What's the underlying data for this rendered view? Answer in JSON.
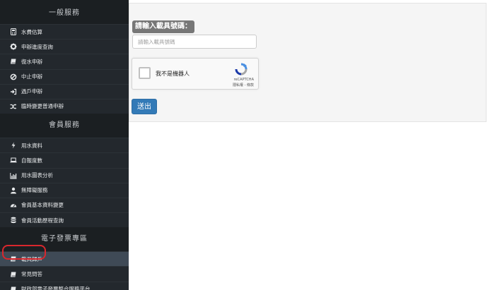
{
  "sidebar": {
    "sections": [
      {
        "title": "一般服務",
        "items": [
          {
            "label": "水費估算",
            "icon": "calculator-icon"
          },
          {
            "label": "申辦進度查詢",
            "icon": "gear-icon"
          },
          {
            "label": "復水申辦",
            "icon": "book-icon"
          },
          {
            "label": "中止申辦",
            "icon": "ban-icon"
          },
          {
            "label": "過戶申辦",
            "icon": "sign-in-icon"
          },
          {
            "label": "臨時變更普通申辦",
            "icon": "shuffle-icon"
          }
        ]
      },
      {
        "title": "會員服務",
        "items": [
          {
            "label": "用水資料",
            "icon": "bolt-icon"
          },
          {
            "label": "自報度數",
            "icon": "laptop-icon"
          },
          {
            "label": "用水圖表分析",
            "icon": "bar-chart-icon"
          },
          {
            "label": "無障礙服務",
            "icon": "user-icon"
          },
          {
            "label": "會員基本資料變更",
            "icon": "dashboard-icon"
          },
          {
            "label": "會員活動歷程查詢",
            "icon": "database-icon"
          }
        ]
      },
      {
        "title": "電子發票專區",
        "items": [
          {
            "label": "載具歸戶",
            "icon": "book-icon",
            "active": true
          },
          {
            "label": "常見問答",
            "icon": "book-icon"
          },
          {
            "label": "財政部電子發票整合服務平台",
            "icon": "book-icon"
          }
        ]
      }
    ]
  },
  "form": {
    "label": "請輸入載具號碼：",
    "input_placeholder": "請輸入載具號碼",
    "input_value": "",
    "recaptcha": {
      "checkbox_label": "我不是機器人",
      "brand": "reCAPTCHA",
      "terms": "隱私權 - 條款"
    },
    "submit_label": "送出"
  },
  "colors": {
    "sidebar_bg": "#23282d",
    "section_header_bg": "#1b1f22",
    "active_item_bg": "#3f4a56",
    "highlight_ring": "#d9272d",
    "submit_button": "#337ab7",
    "label_badge": "#777777"
  }
}
